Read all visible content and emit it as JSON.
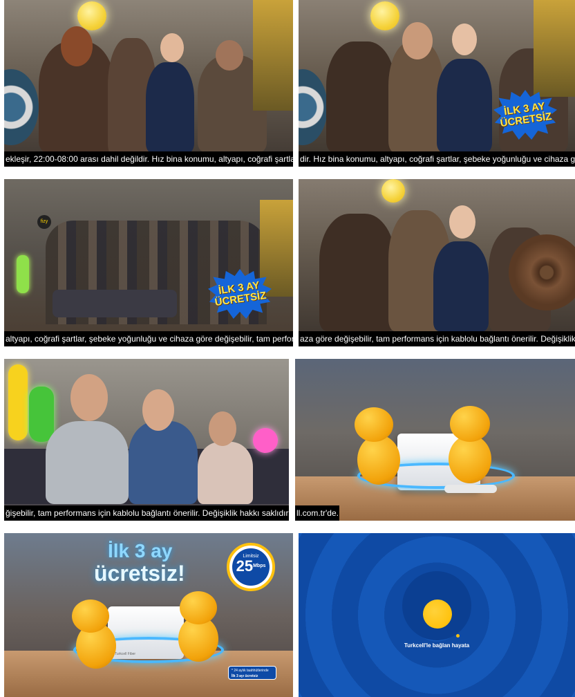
{
  "frames": [
    {
      "subtitle": "ekleşir, 22:00-08:00 arası dahil değildir. Hız bina konumu, altyapı, coğrafi şartlar,"
    },
    {
      "subtitle": "dir. Hız bina konumu, altyapı, coğrafi şartlar, şebeke yoğunluğu ve cihaza göre",
      "badge": {
        "line1": "İLK 3 AY",
        "line2": "ÜCRETSİZ"
      }
    },
    {
      "subtitle": "altyapı, coğrafi şartlar, şebeke yoğunluğu ve cihaza göre değişebilir, tam perform",
      "badge": {
        "line1": "İLK 3 AY",
        "line2": "ÜCRETSİZ"
      },
      "sign": "fizy"
    },
    {
      "subtitle": "aza göre değişebilir, tam performans için kablolu bağlantı önerilir. Değişiklik ha"
    },
    {
      "subtitle": "ğişebilir, tam performans için kablolu bağlantı önerilir. Değişiklik hakkı saklıdır. D"
    },
    {
      "subtitle": "ll.com.tr'de."
    },
    {
      "headline1": "İlk 3 ay",
      "headline2": "ücretsiz!",
      "speed_top": "Limitsiz",
      "speed_value": "25",
      "speed_unit": "Mbps",
      "router_brand": "Turkcell Fiber",
      "note_line1": "* 24 aylık taahhütlerinde",
      "note_line2": "İlk 3 ayı ücretsiz"
    },
    {
      "tagline": "Turkcell'le bağlan hayata"
    }
  ],
  "colors": {
    "subtitle_bg": "#000000",
    "badge_blue": "#1565d8",
    "badge_text": "#ffe54a",
    "brand_blue": "#0e4aa6",
    "brand_yellow": "#ffc20e"
  }
}
